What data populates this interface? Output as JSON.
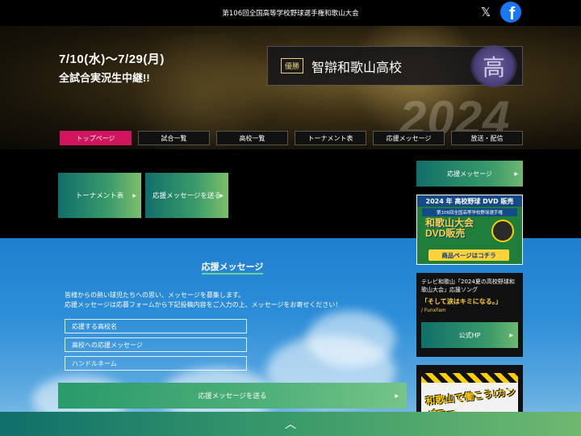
{
  "header": {
    "title": "第106回全国高等学校野球選手権和歌山大会",
    "x_icon": "x-icon",
    "facebook_icon": "facebook-icon"
  },
  "hero": {
    "dates": "7/10(水)〜7/29(月)",
    "live": "全試合実況生中継!!",
    "year": "2024",
    "winner_badge": "優勝",
    "winner_school": "智辯和歌山高校",
    "emblem_glyph": "高"
  },
  "nav": {
    "tabs": [
      {
        "label": "トップページ",
        "active": true
      },
      {
        "label": "試合一覧",
        "active": false
      },
      {
        "label": "高校一覧",
        "active": false
      },
      {
        "label": "トーナメント表",
        "active": false
      },
      {
        "label": "応援メッセージ",
        "active": false
      },
      {
        "label": "放送・配信",
        "active": false
      }
    ]
  },
  "quick_links": {
    "tournament": "トーナメント表",
    "send_message": "応援メッセージを送る"
  },
  "message_section": {
    "title": "応援メッセージ",
    "desc_line1": "皆様からの熱い球児たちへの思い、メッセージを募集します。",
    "desc_line2": "応援メッセージは応募フォームから下記投稿内容をご入力の上、メッセージをお寄せください！",
    "fields": [
      "応援する高校名",
      "高校への応援メッセージ",
      "ハンドルネーム"
    ],
    "submit": "応援メッセージを送る"
  },
  "sidebar": {
    "message_button": "応援メッセージ",
    "dvd": {
      "header": "2024 年 高校野球 DVD 販売",
      "sub": "第106回全国高等学校野球選手権",
      "big1": "和歌山大会",
      "big2": "DVD販売",
      "cta": "商品ページはコチラ"
    },
    "song": {
      "text": "テレビ和歌山「2024夏の高校野球和歌山大会」応援ソング",
      "name": "「そして涙はキミになる。」",
      "artist": "/ FunxFam",
      "hp": "公式HP"
    },
    "company": {
      "title": "和歌山で働こう!カンパニー"
    }
  },
  "footer": {
    "up_icon": "chevron-up-icon"
  }
}
